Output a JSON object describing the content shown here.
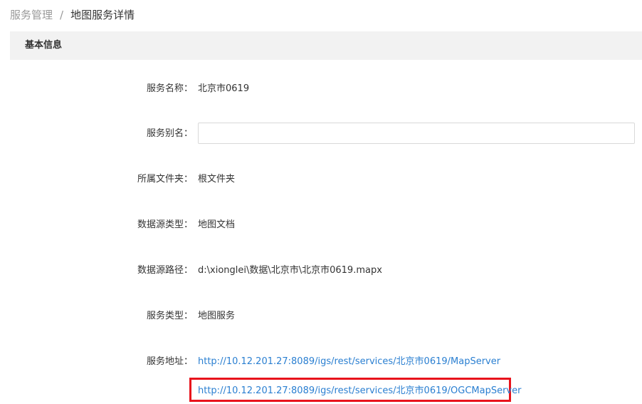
{
  "breadcrumb": {
    "parent": "服务管理",
    "separator": "/",
    "current": "地图服务详情"
  },
  "section": {
    "title": "基本信息"
  },
  "fields": {
    "service_name": {
      "label": "服务名称：",
      "value": "北京市0619"
    },
    "service_alias": {
      "label": "服务别名：",
      "value": "",
      "placeholder": ""
    },
    "folder": {
      "label": "所属文件夹：",
      "value": "根文件夹"
    },
    "datasource_type": {
      "label": "数据源类型：",
      "value": "地图文档"
    },
    "datasource_path": {
      "label": "数据源路径：",
      "value": "d:\\xionglei\\数据\\北京市\\北京市0619.mapx"
    },
    "service_type": {
      "label": "服务类型：",
      "value": "地图服务"
    },
    "service_address": {
      "label": "服务地址：",
      "links": [
        "http://10.12.201.27:8089/igs/rest/services/北京市0619/MapServer",
        "http://10.12.201.27:8089/igs/rest/services/北京市0619/OGCMapServer"
      ]
    }
  },
  "colors": {
    "link": "#2a7fd1",
    "highlight_box": "#e8131c",
    "section_bg": "#f2f2f2"
  }
}
